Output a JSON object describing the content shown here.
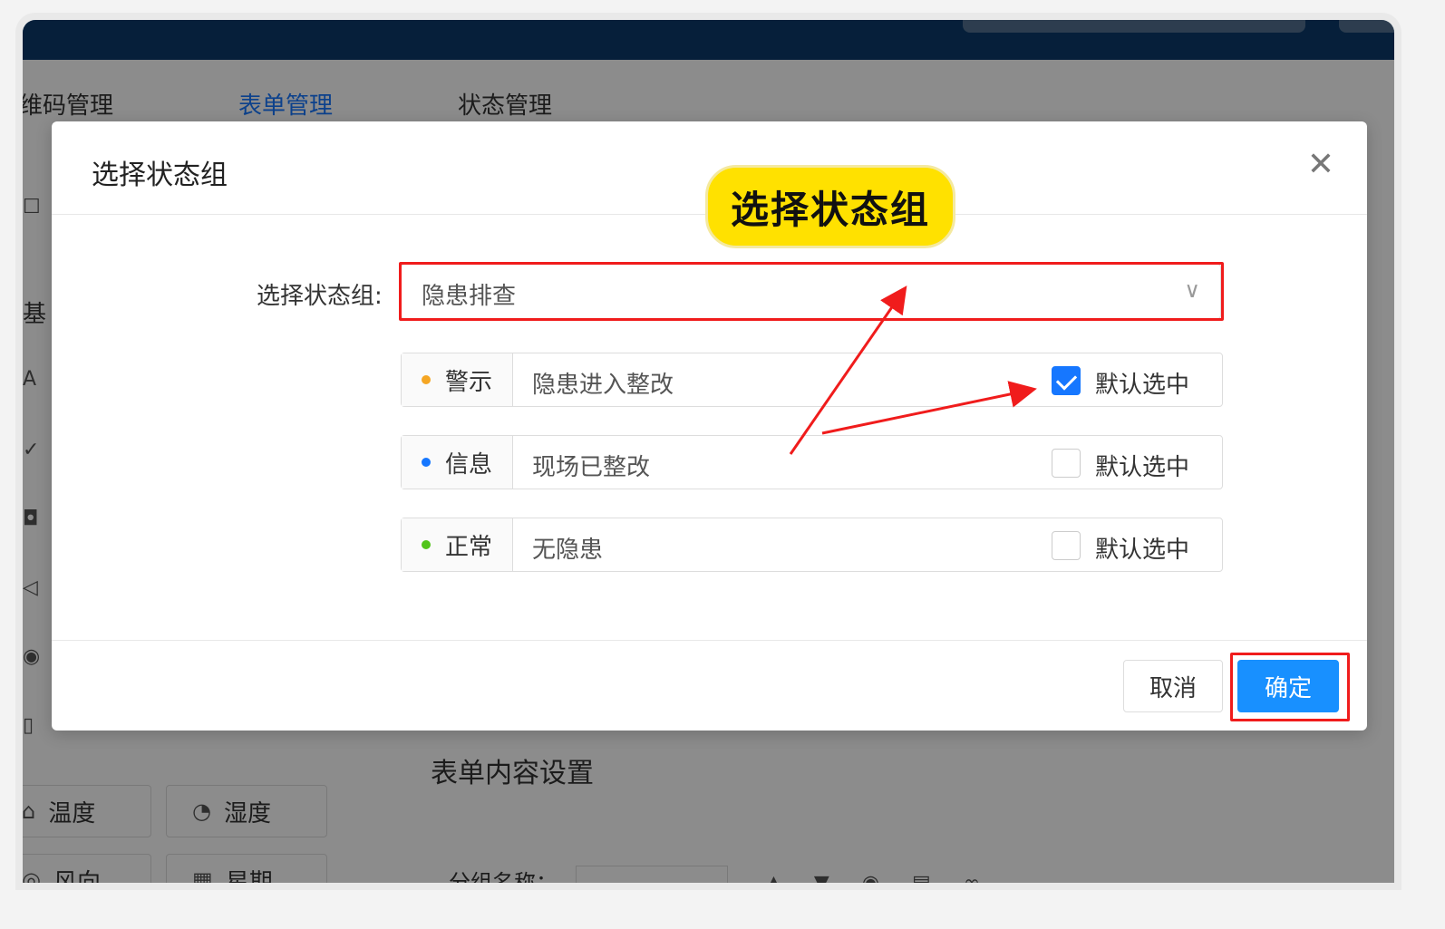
{
  "tabs": [
    {
      "label": "维码管理"
    },
    {
      "label": "表单管理"
    },
    {
      "label": "状态管理"
    }
  ],
  "sidebar": {
    "partial_label": "基",
    "buttons": [
      {
        "label": "温度",
        "icon": "thermometer-icon"
      },
      {
        "label": "湿度",
        "icon": "gauge-icon"
      },
      {
        "label": "风向",
        "icon": "compass-icon"
      },
      {
        "label": "星期",
        "icon": "calendar-icon"
      }
    ]
  },
  "form": {
    "section_title": "表单内容设置",
    "group_name_label": "分组名称："
  },
  "dialog": {
    "title": "选择状态组",
    "callout": "选择状态组",
    "field_label": "选择状态组:",
    "select_value": "隐患排查",
    "statuses": [
      {
        "tag": "警示",
        "desc": "隐患进入整改",
        "color": "#f5a623",
        "default_checked": true,
        "check_label": "默认选中"
      },
      {
        "tag": "信息",
        "desc": "现场已整改",
        "color": "#1677ff",
        "default_checked": false,
        "check_label": "默认选中"
      },
      {
        "tag": "正常",
        "desc": "无隐患",
        "color": "#52c41a",
        "default_checked": false,
        "check_label": "默认选中"
      }
    ],
    "cancel_label": "取消",
    "ok_label": "确定"
  },
  "colors": {
    "topbar": "#0b3a6b",
    "primary": "#1890ff",
    "highlight_red": "#f01c1c",
    "callout_yellow": "#ffe100"
  }
}
